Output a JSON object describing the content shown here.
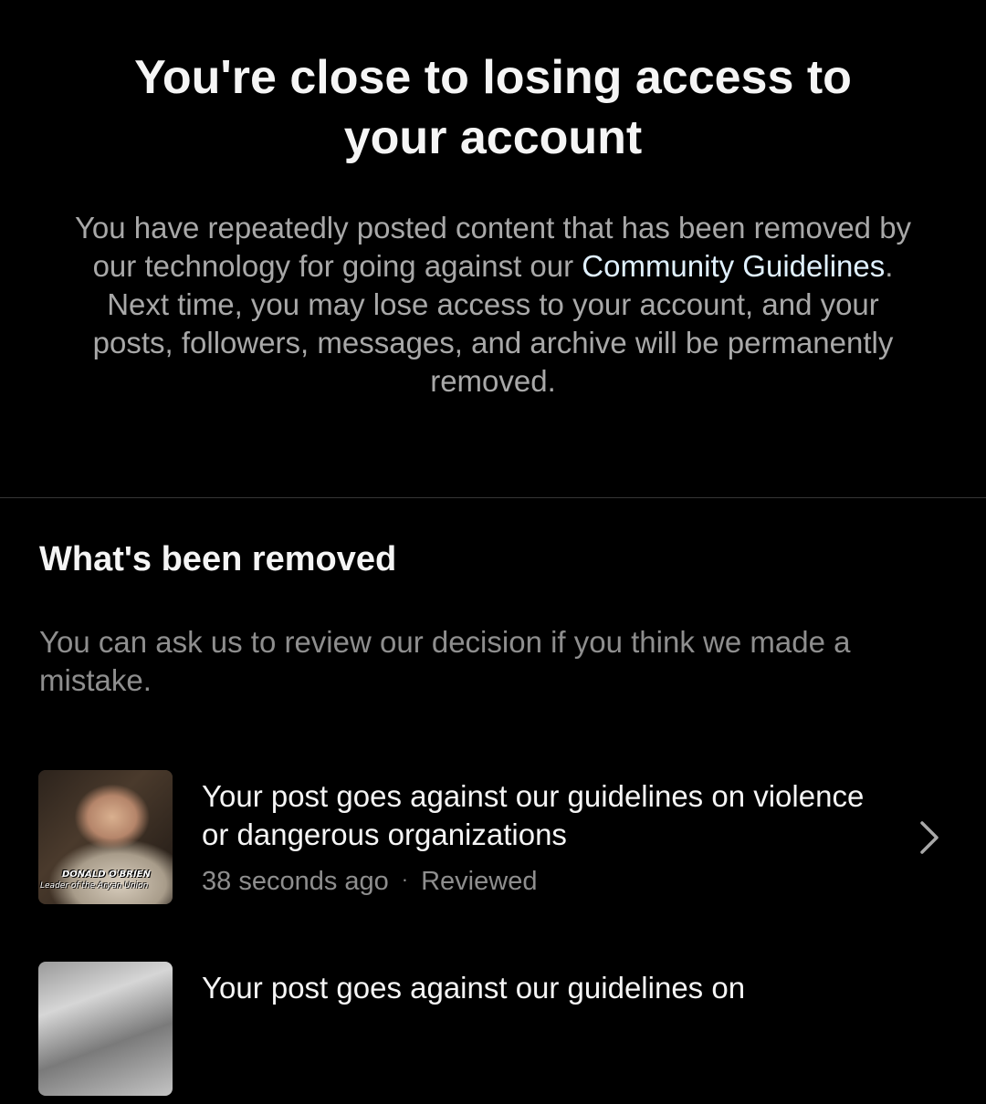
{
  "header": {
    "title": "You're close to losing access to your account",
    "body_before_link": "You have repeatedly posted content that has been removed by our technology for going against our ",
    "link_text": "Community Guidelines",
    "body_after_link": ". Next time, you may lose access to your account, and your posts, followers, messages, and archive will be permanently removed."
  },
  "section": {
    "title": "What's been removed",
    "description": "You can ask us to review our decision if you think we made a mistake."
  },
  "items": [
    {
      "title": "Your post goes against our guidelines on violence or dangerous organizations",
      "time": "38 seconds ago",
      "separator": "·",
      "status": "Reviewed",
      "thumbnail_caption_name": "DONALD O'BRIEN",
      "thumbnail_caption_sub": "Leader of the Aryan Union"
    },
    {
      "title": "Your post goes against our guidelines on"
    }
  ],
  "colors": {
    "background": "#000000",
    "primary_text": "#f5f5f5",
    "secondary_text": "#a8a8a8",
    "muted_text": "#8e8e8e",
    "link": "#e0f1ff",
    "divider": "#363636"
  }
}
